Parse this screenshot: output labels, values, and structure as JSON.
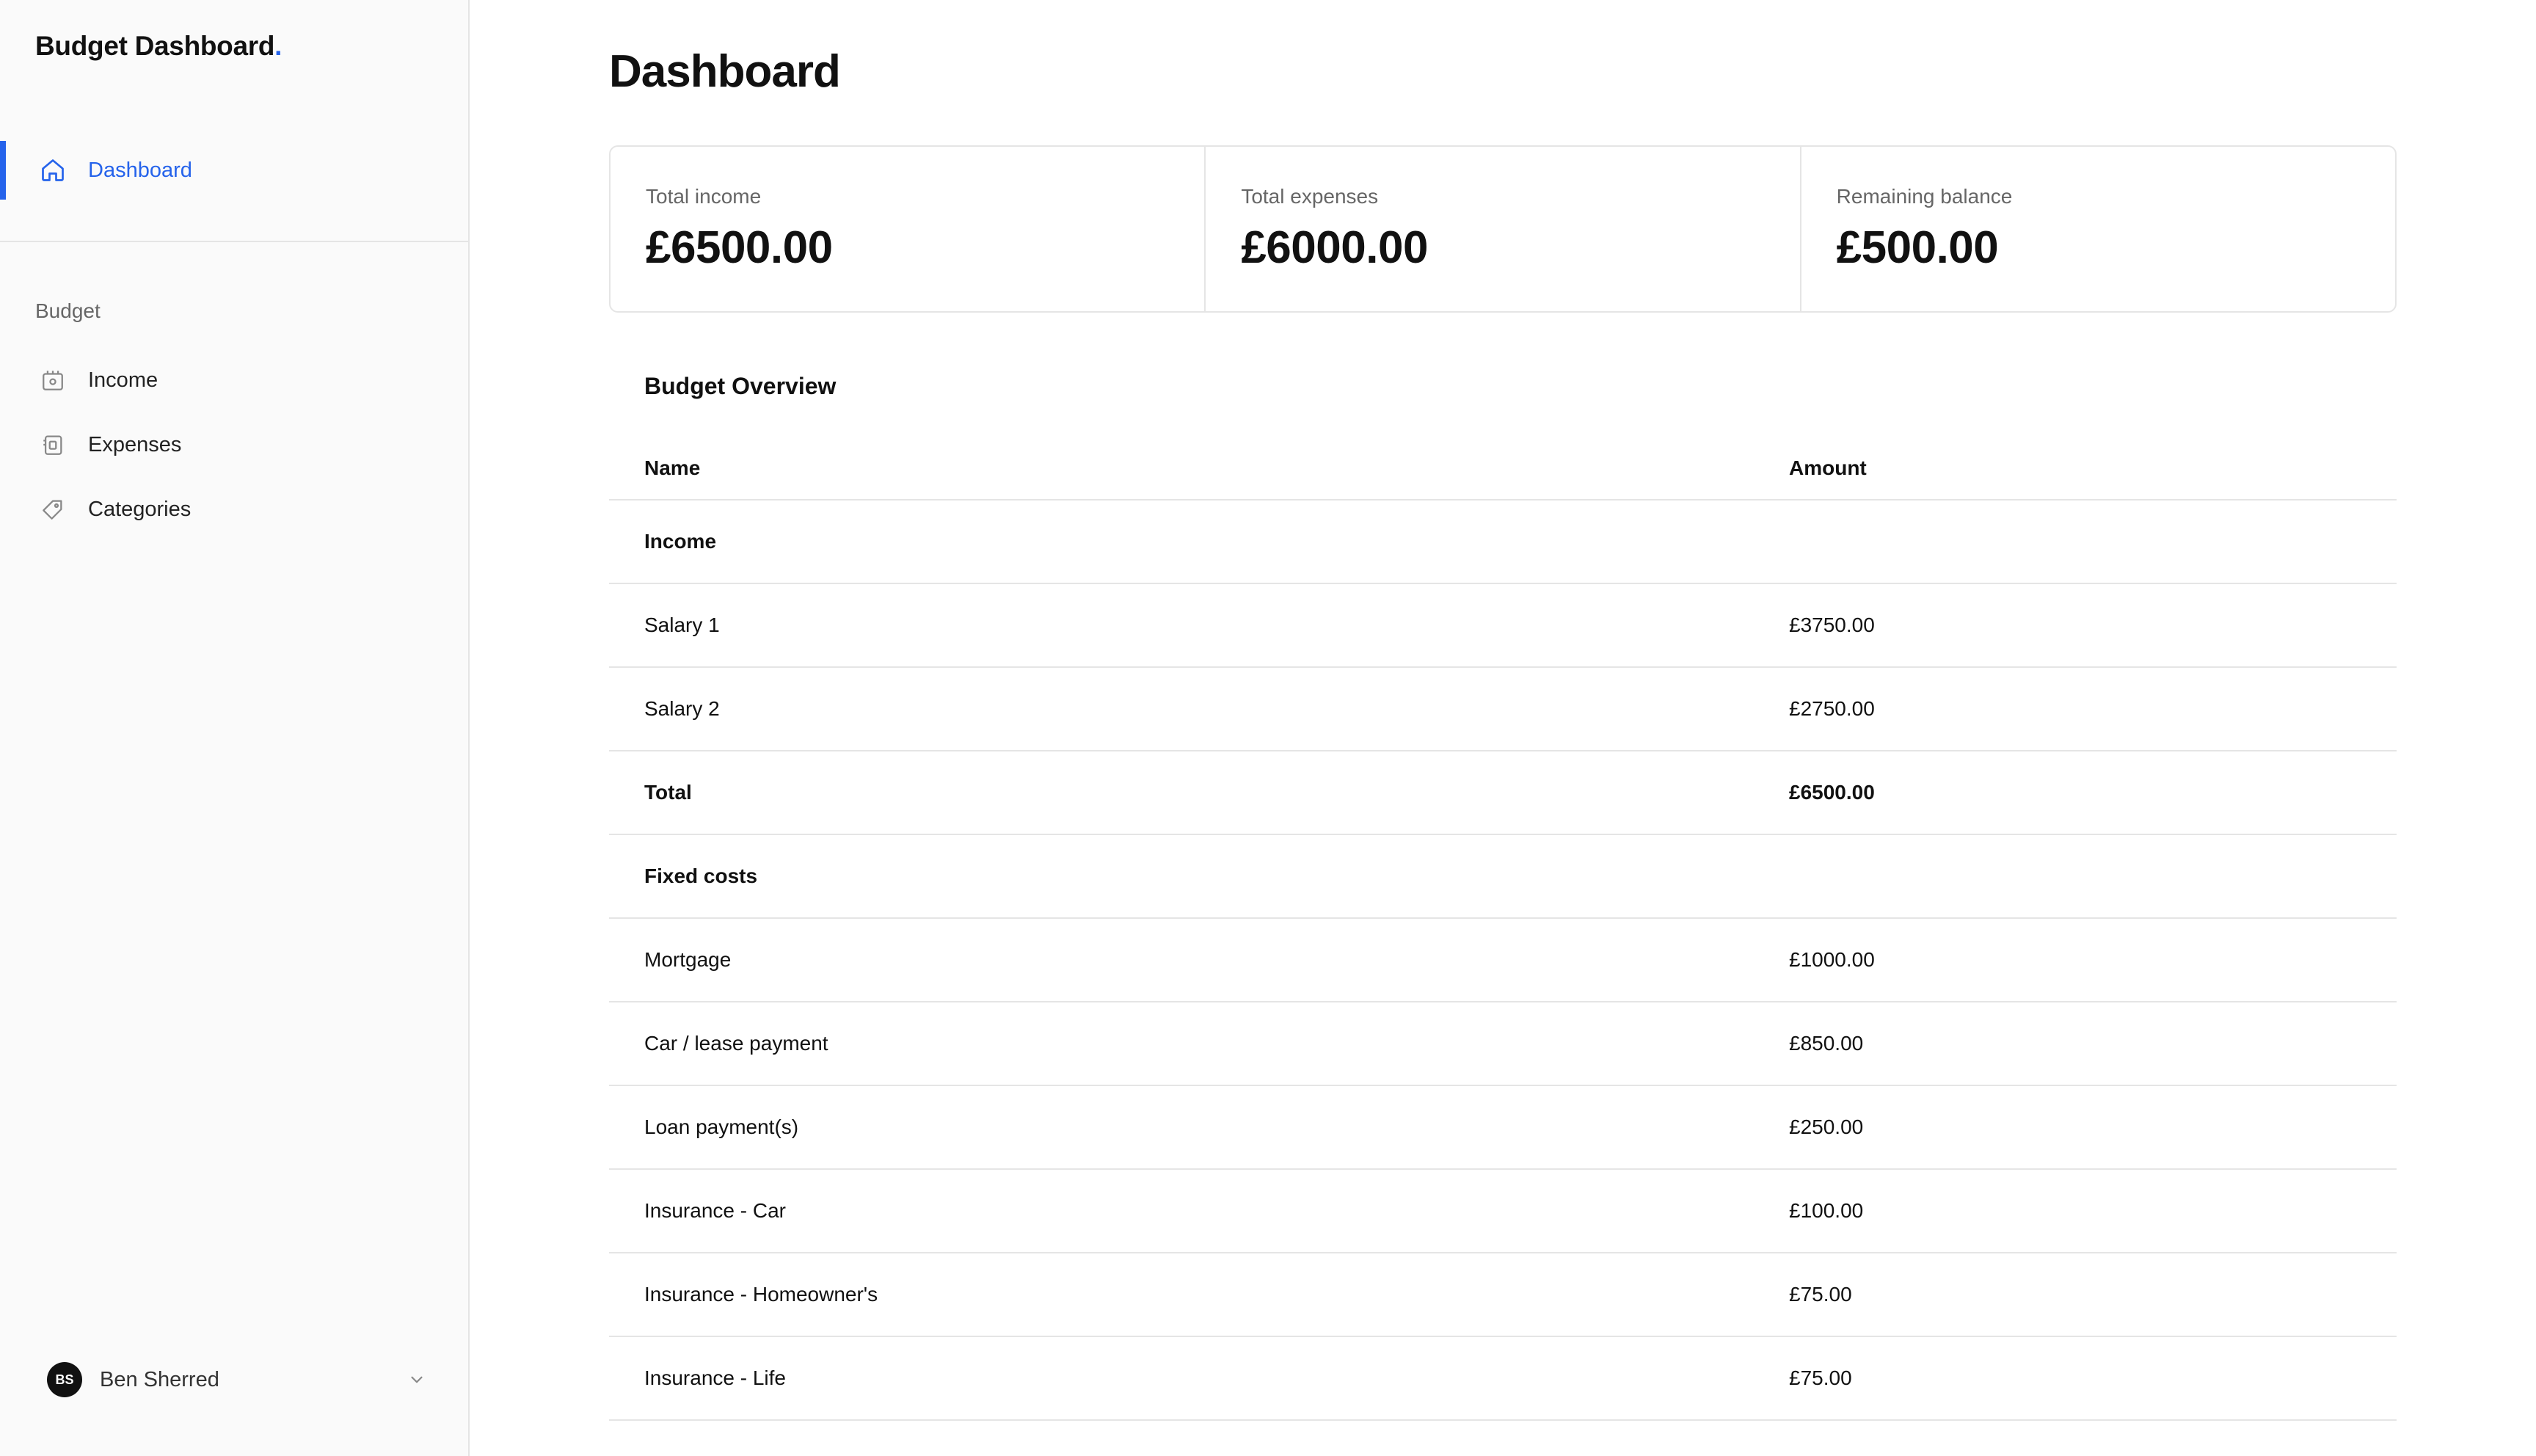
{
  "sidebar": {
    "brand": "Budget Dashboard",
    "brand_dot": ".",
    "primary_nav": [
      {
        "label": "Dashboard",
        "icon": "home-icon",
        "active": true
      }
    ],
    "section_label": "Budget",
    "budget_nav": [
      {
        "label": "Income",
        "icon": "income-icon"
      },
      {
        "label": "Expenses",
        "icon": "expenses-icon"
      },
      {
        "label": "Categories",
        "icon": "tag-icon"
      }
    ],
    "user": {
      "initials": "BS",
      "name": "Ben Sherred"
    }
  },
  "main": {
    "title": "Dashboard",
    "stats": [
      {
        "label": "Total income",
        "value": "£6500.00"
      },
      {
        "label": "Total expenses",
        "value": "£6000.00"
      },
      {
        "label": "Remaining balance",
        "value": "£500.00"
      }
    ],
    "overview": {
      "title": "Budget Overview",
      "columns": {
        "name": "Name",
        "amount": "Amount"
      },
      "rows": [
        {
          "name": "Income",
          "amount": "",
          "bold": true
        },
        {
          "name": "Salary 1",
          "amount": "£3750.00",
          "bold": false
        },
        {
          "name": "Salary 2",
          "amount": "£2750.00",
          "bold": false
        },
        {
          "name": "Total",
          "amount": "£6500.00",
          "bold": true
        },
        {
          "name": "Fixed costs",
          "amount": "",
          "bold": true
        },
        {
          "name": "Mortgage",
          "amount": "£1000.00",
          "bold": false
        },
        {
          "name": "Car / lease payment",
          "amount": "£850.00",
          "bold": false
        },
        {
          "name": "Loan payment(s)",
          "amount": "£250.00",
          "bold": false
        },
        {
          "name": "Insurance - Car",
          "amount": "£100.00",
          "bold": false
        },
        {
          "name": "Insurance - Homeowner's",
          "amount": "£75.00",
          "bold": false
        },
        {
          "name": "Insurance - Life",
          "amount": "£75.00",
          "bold": false
        }
      ]
    }
  },
  "colors": {
    "accent": "#2563eb",
    "border": "#e5e5e5",
    "sidebar_bg": "#fafafa"
  }
}
